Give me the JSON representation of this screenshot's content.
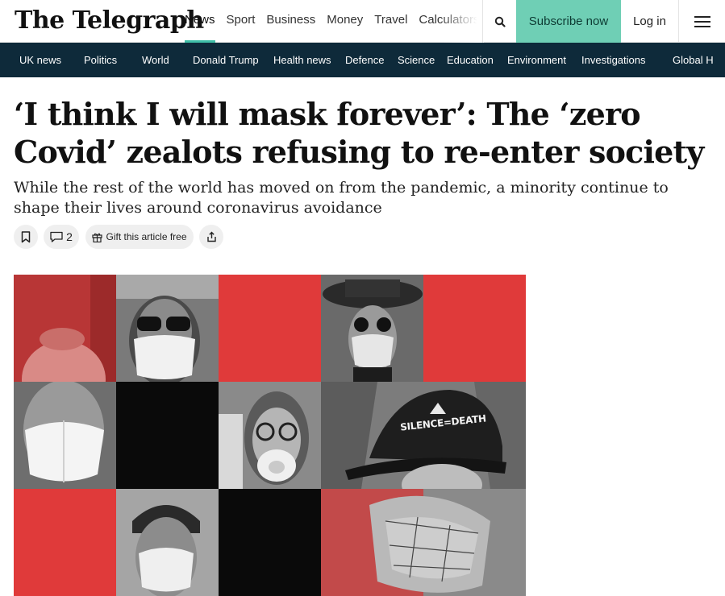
{
  "header": {
    "logo": "The Telegraph",
    "nav": [
      "News",
      "Sport",
      "Business",
      "Money",
      "Travel",
      "Calculators"
    ],
    "active_nav": "News",
    "subscribe_label": "Subscribe now",
    "login_label": "Log in",
    "search_icon": "search-icon",
    "menu_icon": "hamburger-menu-icon"
  },
  "sections": [
    "UK news",
    "Politics",
    "World",
    "Donald Trump",
    "Health news",
    "Defence",
    "Science",
    "Education",
    "Environment",
    "Investigations",
    "Global H"
  ],
  "article": {
    "headline": "‘I think I will mask forever’: The ‘zero Covid’ zealots refusing to re-enter society",
    "standfirst": "While the rest of the world has moved on from the pandemic, a minority continue to shape their lives around coronavirus avoidance",
    "comment_count": "2",
    "gift_label": "Gift this article free",
    "cap_text": "SILENCE=DEATH"
  },
  "colors": {
    "accent": "#6fcfb5",
    "nav_active_underline": "#3fbfa8",
    "section_bar": "#0e2a3a",
    "collage_red": "#e03a3a"
  }
}
